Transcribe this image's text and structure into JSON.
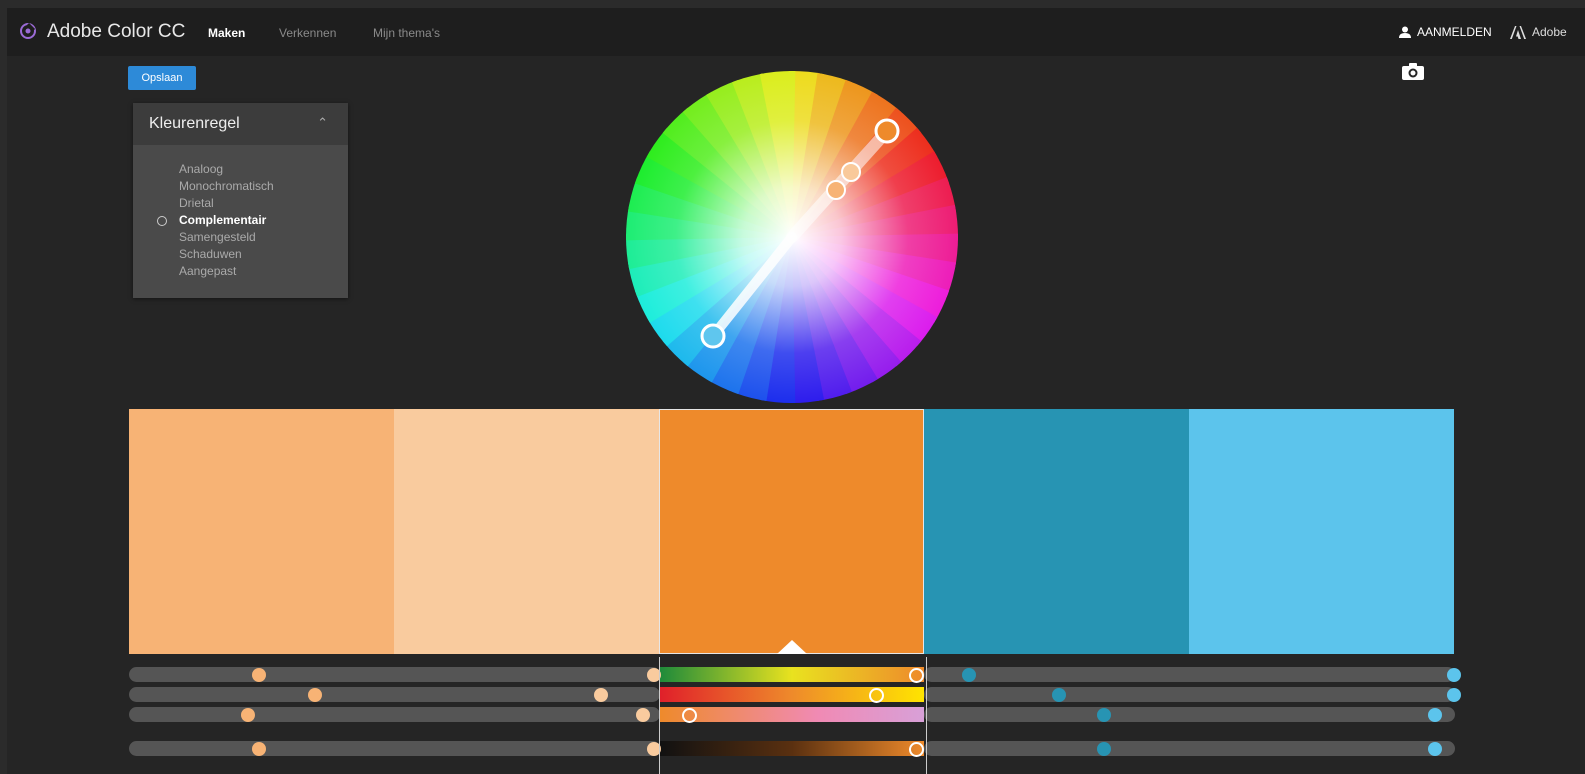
{
  "app": {
    "title": "Adobe Color CC",
    "nav": [
      "Maken",
      "Verkennen",
      "Mijn thema's"
    ],
    "active_nav": "Maken",
    "signin_label": "AANMELDEN",
    "adobe_label": "Adobe"
  },
  "toolbar": {
    "save_label": "Opslaan"
  },
  "rule_panel": {
    "title": "Kleurenregel",
    "rules": [
      "Analoog",
      "Monochromatisch",
      "Drietal",
      "Complementair",
      "Samengesteld",
      "Schaduwen",
      "Aangepast"
    ],
    "selected": "Complementair"
  },
  "swatches": [
    {
      "color": "#f7b375"
    },
    {
      "color": "#f9cb9e"
    },
    {
      "color": "#ee8a2b",
      "selected": true
    },
    {
      "color": "#2794b3"
    },
    {
      "color": "#5cc4ec"
    }
  ],
  "icons": {
    "logo": "color-wheel-logo-icon",
    "user": "user-icon",
    "adobe": "adobe-logo-icon",
    "camera": "camera-icon",
    "collapse": "chevron-up-icon"
  },
  "sliders": {
    "rows": 4,
    "values": [
      [
        0.49,
        0.98,
        0.97,
        0.17,
        1.0
      ],
      [
        0.7,
        0.78,
        0.82,
        0.51,
        1.0
      ],
      [
        0.45,
        0.94,
        0.11,
        0.68,
        0.93
      ],
      [
        0.49,
        0.98,
        0.97,
        0.68,
        0.93
      ]
    ]
  }
}
